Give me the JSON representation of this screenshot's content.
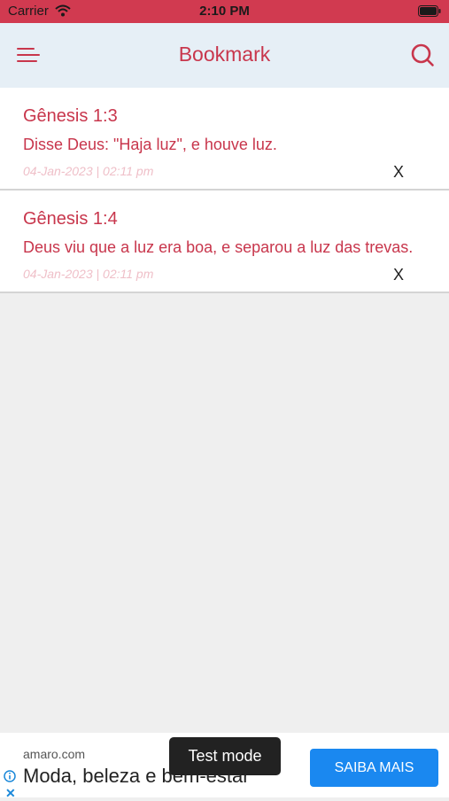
{
  "status_bar": {
    "carrier": "Carrier",
    "time": "2:10 PM"
  },
  "header": {
    "title": "Bookmark"
  },
  "bookmarks": [
    {
      "reference": "Gênesis 1:3",
      "text": "Disse Deus: \"Haja luz\", e houve luz.",
      "date": "04-Jan-2023 | 02:11 pm",
      "remove_label": "X"
    },
    {
      "reference": "Gênesis 1:4",
      "text": "Deus viu que a luz era boa, e separou a luz das trevas.",
      "date": "04-Jan-2023 | 02:11 pm",
      "remove_label": "X"
    }
  ],
  "ad": {
    "domain": "amaro.com",
    "headline": "Moda, beleza e bem-estar",
    "cta": "SAIBA MAIS",
    "badge": "Test mode"
  },
  "colors": {
    "accent": "#c8364c",
    "status_bar": "#d13a50",
    "nav_bg": "#e6eff6",
    "cta": "#1a88f0"
  },
  "icons": {
    "menu": "menu-lines-icon",
    "search": "search-icon",
    "wifi": "wifi-icon",
    "battery": "battery-icon",
    "info": "info-icon",
    "close": "close-icon"
  }
}
